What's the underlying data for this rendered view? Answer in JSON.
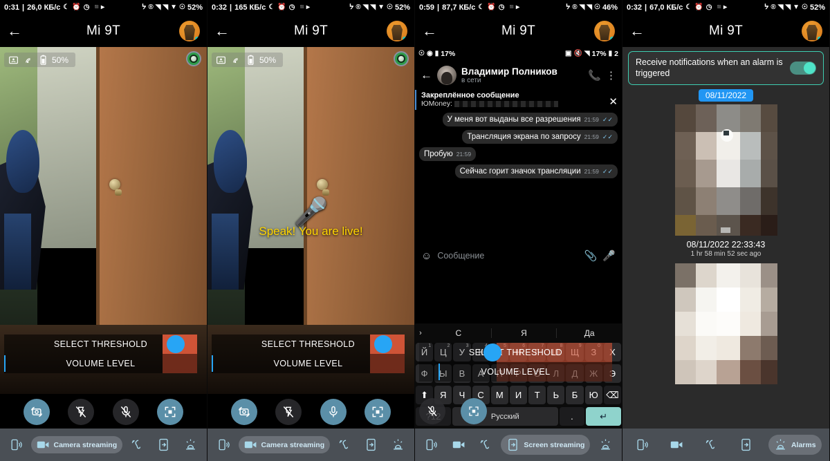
{
  "panels": [
    {
      "statusbar": {
        "time": "0:31",
        "speed": "26,0 КБ/c",
        "left_icons": [
          "moon-icon",
          "alarm-icon",
          "clock-icon",
          "video-record-icon"
        ],
        "right_icons": [
          "bluetooth-icon",
          "registered-icon",
          "signal-1-icon",
          "signal-2-icon",
          "wifi-icon",
          "dnd-icon"
        ],
        "battery": "52%"
      },
      "appbar": {
        "back": "←",
        "title": "Mi 9T"
      },
      "overlay": {
        "camera_icon": "camera-person-icon",
        "wifi_icon": "wifi-cast-icon",
        "battery_icon": "battery-icon",
        "battery_text": "50%",
        "badge": "webcam-badge-icon"
      },
      "threshold": {
        "select_label": "SELECT THRESHOLD",
        "volume_label": "VOLUME LEVEL"
      },
      "fabs": [
        {
          "name": "switch-camera-button",
          "icon": "camera-switch-icon",
          "active": true
        },
        {
          "name": "flash-off-button",
          "icon": "flash-off-icon",
          "active": false
        },
        {
          "name": "mic-off-button",
          "icon": "mic-off-icon",
          "active": false
        },
        {
          "name": "fullscreen-button",
          "icon": "fullscreen-icon",
          "active": true
        }
      ],
      "nav": [
        {
          "name": "nav-audio-streaming",
          "icon": "phone-sound-icon",
          "label": "",
          "selected": false
        },
        {
          "name": "nav-camera-streaming",
          "icon": "video-camera-icon",
          "label": "Camera streaming",
          "selected": true
        },
        {
          "name": "nav-listening",
          "icon": "ear-icon",
          "label": "",
          "selected": false
        },
        {
          "name": "nav-screen-streaming",
          "icon": "screen-share-icon",
          "label": "",
          "selected": false
        },
        {
          "name": "nav-alarms",
          "icon": "siren-icon",
          "label": "",
          "selected": false
        }
      ]
    },
    {
      "statusbar": {
        "time": "0:32",
        "speed": "165 КБ/c",
        "battery": "52%"
      },
      "appbar": {
        "back": "←",
        "title": "Mi 9T"
      },
      "overlay": {
        "battery_text": "50%"
      },
      "speak": {
        "mic_icon": "microphone-icon",
        "text": "Speak! You are live!"
      },
      "threshold": {
        "select_label": "SELECT THRESHOLD",
        "volume_label": "VOLUME LEVEL"
      },
      "fabs": [
        {
          "name": "switch-camera-button",
          "icon": "camera-switch-icon",
          "active": true
        },
        {
          "name": "flash-off-button",
          "icon": "flash-off-icon",
          "active": false
        },
        {
          "name": "mic-on-button",
          "icon": "mic-on-icon",
          "active": true
        },
        {
          "name": "fullscreen-button",
          "icon": "fullscreen-icon",
          "active": true
        }
      ],
      "nav": [
        {
          "name": "nav-audio-streaming",
          "icon": "phone-sound-icon",
          "label": "",
          "selected": false
        },
        {
          "name": "nav-camera-streaming",
          "icon": "video-camera-icon",
          "label": "Camera streaming",
          "selected": true
        },
        {
          "name": "nav-listening",
          "icon": "ear-icon",
          "label": "",
          "selected": false
        },
        {
          "name": "nav-screen-streaming",
          "icon": "screen-share-icon",
          "label": "",
          "selected": false
        },
        {
          "name": "nav-alarms",
          "icon": "siren-icon",
          "label": "",
          "selected": false
        }
      ]
    },
    {
      "statusbar": {
        "time": "0:59",
        "speed": "87,7 КБ/c",
        "battery": "46%"
      },
      "appbar": {
        "back": "←",
        "title": "Mi 9T"
      },
      "inner_status": {
        "battery_text": "17%",
        "right_text": "17%",
        "right_text2": "2"
      },
      "telegram": {
        "back": "←",
        "contact": "Владимир Полников",
        "status": "в сети",
        "mute_icon": "mute-icon",
        "call_icon": "phone-icon",
        "menu_icon": "more-vert-icon",
        "pinned_title": "Закреплённое сообщение",
        "pinned_sub": "ЮMoney:",
        "close_icon": "✕",
        "messages": [
          {
            "text": "У меня вот выданы все разрешения",
            "time": "21:59",
            "out": true,
            "read": true
          },
          {
            "text": "Трансляция экрана по запросу",
            "time": "21:59",
            "out": true,
            "read": true
          },
          {
            "text": "Пробую",
            "time": "21:59",
            "out": false,
            "read": false
          },
          {
            "text": "Сейчас горит значок трансляции",
            "time": "21:59",
            "out": true,
            "read": true
          }
        ],
        "input_placeholder": "Сообщение",
        "emoji_icon": "emoji-icon",
        "attach_icon": "paperclip-icon",
        "voice_icon": "microphone-icon"
      },
      "keyboard": {
        "suggestions": [
          "С",
          "Я",
          "Да"
        ],
        "row1": [
          {
            "k": "Й",
            "n": "1"
          },
          {
            "k": "Ц",
            "n": "2"
          },
          {
            "k": "У",
            "n": "3"
          },
          {
            "k": "К",
            "n": "4"
          },
          {
            "k": "Е",
            "n": "5"
          },
          {
            "k": "Н",
            "n": "6"
          },
          {
            "k": "Г",
            "n": "7"
          },
          {
            "k": "Ш",
            "n": "8"
          },
          {
            "k": "Щ",
            "n": "9"
          },
          {
            "k": "З",
            "n": "0"
          },
          {
            "k": "Х",
            "n": ""
          }
        ],
        "row2": [
          "Ф",
          "Ы",
          "В",
          "А",
          "П",
          "Р",
          "О",
          "Л",
          "Д",
          "Ж",
          "Э"
        ],
        "row3": [
          "⬆",
          "Я",
          "Ч",
          "С",
          "М",
          "И",
          "Т",
          "Ь",
          "Б",
          "Ю",
          "⌫"
        ],
        "row4": {
          "sym": "?12",
          "space": "Русский",
          "dot": ".",
          "enter": "↵"
        }
      },
      "threshold": {
        "select_label": "SELECT THRESHOLD",
        "volume_label": "VOLUME LEVEL"
      },
      "fabs": [
        {
          "name": "mic-off-button",
          "icon": "mic-off-icon",
          "active": false
        },
        {
          "name": "fullscreen-button",
          "icon": "fullscreen-icon",
          "active": true
        }
      ],
      "nav": [
        {
          "name": "nav-audio-streaming",
          "icon": "phone-sound-icon",
          "label": "",
          "selected": false
        },
        {
          "name": "nav-camera-streaming",
          "icon": "video-camera-icon",
          "label": "",
          "selected": false
        },
        {
          "name": "nav-listening",
          "icon": "ear-icon",
          "label": "",
          "selected": false
        },
        {
          "name": "nav-screen-streaming",
          "icon": "screen-share-icon",
          "label": "Screen streaming",
          "selected": true
        },
        {
          "name": "nav-alarms",
          "icon": "siren-icon",
          "label": "",
          "selected": false
        }
      ]
    },
    {
      "statusbar": {
        "time": "0:32",
        "speed": "67,0 КБ/c",
        "battery": "52%"
      },
      "appbar": {
        "back": "←",
        "title": "Mi 9T"
      },
      "alarms": {
        "notification_text": "Receive notifications when an alarm is triggered",
        "toggle_on": true,
        "date_chip": "08/11/2022",
        "entries": [
          {
            "timestamp": "08/11/2022 22:33:43",
            "ago": "1 hr 58 min 52 sec  ago"
          }
        ]
      },
      "nav": [
        {
          "name": "nav-audio-streaming",
          "icon": "phone-sound-icon",
          "label": "",
          "selected": false
        },
        {
          "name": "nav-camera-streaming",
          "icon": "video-camera-icon",
          "label": "",
          "selected": false
        },
        {
          "name": "nav-listening",
          "icon": "ear-icon",
          "label": "",
          "selected": false
        },
        {
          "name": "nav-screen-streaming",
          "icon": "screen-share-icon",
          "label": "",
          "selected": false
        },
        {
          "name": "nav-alarms",
          "icon": "siren-icon",
          "label": "Alarms",
          "selected": true
        }
      ]
    }
  ],
  "colors": {
    "accent_blue": "#27a5f5",
    "nav_bg": "#4a4f55",
    "nav_icon": "#a8d8ea",
    "fab_active": "#5b8fa8",
    "threshold_red": "#f06040",
    "toggle_green": "#4fe3c8",
    "date_chip_blue": "#2196f3",
    "speak_yellow": "#ffd500"
  }
}
